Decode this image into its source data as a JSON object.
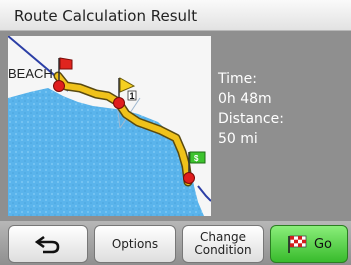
{
  "window": {
    "title": "Route Calculation Result"
  },
  "map": {
    "place_label": "BEACH",
    "waypoint_1": "1",
    "destination_marker": "$"
  },
  "route_info": {
    "time_label": "Time:",
    "time_value": "0h 48m",
    "distance_label": "Distance:",
    "distance_value": "50 mi"
  },
  "buttons": {
    "options_label": "Options",
    "change_line1": "Change",
    "change_line2": "Condition",
    "go_label": "Go"
  },
  "colors": {
    "route": "#f0c21a",
    "water": "#5ab4ec",
    "go_button": "#4ccf3e",
    "start_flag": "#e0241e",
    "pin": "#e01d1d"
  }
}
